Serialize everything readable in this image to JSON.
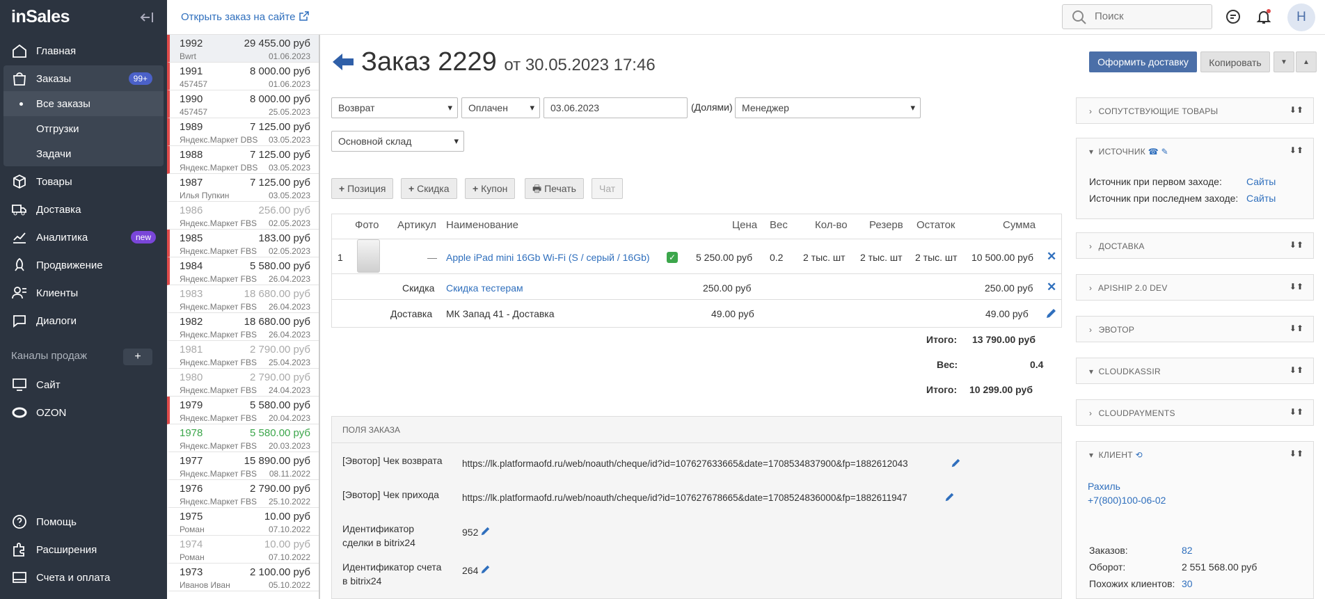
{
  "app": {
    "logo": "inSales",
    "open_site": "Открыть заказ на сайте",
    "search_placeholder": "Поиск",
    "avatar": "Н"
  },
  "nav": {
    "main": "Главная",
    "orders": "Заказы",
    "orders_badge": "99+",
    "all_orders": "Все заказы",
    "shipments": "Отгрузки",
    "tasks": "Задачи",
    "products": "Товары",
    "delivery": "Доставка",
    "analytics": "Аналитика",
    "analytics_badge": "new",
    "promo": "Продвижение",
    "clients": "Клиенты",
    "dialogs": "Диалоги",
    "channels": "Каналы продаж",
    "channels_plus": "+",
    "site": "Сайт",
    "ozon": "OZON",
    "help": "Помощь",
    "extensions": "Расширения",
    "billing": "Счета и оплата"
  },
  "orders": [
    {
      "num": "1992",
      "sum": "29 455.00 руб",
      "src": "Bwrt",
      "date": "01.06.2023",
      "flag": "red"
    },
    {
      "num": "1991",
      "sum": "8 000.00 руб",
      "src": "457457",
      "date": "01.06.2023",
      "flag": "red"
    },
    {
      "num": "1990",
      "sum": "8 000.00 руб",
      "src": "457457",
      "date": "25.05.2023",
      "flag": "red"
    },
    {
      "num": "1989",
      "sum": "7 125.00 руб",
      "src": "Яндекс.Маркет DBS",
      "date": "03.05.2023",
      "flag": "red"
    },
    {
      "num": "1988",
      "sum": "7 125.00 руб",
      "src": "Яндекс.Маркет DBS",
      "date": "03.05.2023",
      "flag": "red"
    },
    {
      "num": "1987",
      "sum": "7 125.00 руб",
      "src": "Илья Пупкин",
      "date": "03.05.2023",
      "flag": ""
    },
    {
      "num": "1986",
      "sum": "256.00 руб",
      "src": "Яндекс.Маркет FBS",
      "date": "02.05.2023",
      "flag": "muted"
    },
    {
      "num": "1985",
      "sum": "183.00 руб",
      "src": "Яндекс.Маркет FBS",
      "date": "02.05.2023",
      "flag": "red"
    },
    {
      "num": "1984",
      "sum": "5 580.00 руб",
      "src": "Яндекс.Маркет FBS",
      "date": "26.04.2023",
      "flag": "red"
    },
    {
      "num": "1983",
      "sum": "18 680.00 руб",
      "src": "Яндекс.Маркет FBS",
      "date": "26.04.2023",
      "flag": "muted"
    },
    {
      "num": "1982",
      "sum": "18 680.00 руб",
      "src": "Яндекс.Маркет FBS",
      "date": "26.04.2023",
      "flag": ""
    },
    {
      "num": "1981",
      "sum": "2 790.00 руб",
      "src": "Яндекс.Маркет FBS",
      "date": "25.04.2023",
      "flag": "muted"
    },
    {
      "num": "1980",
      "sum": "2 790.00 руб",
      "src": "Яндекс.Маркет FBS",
      "date": "24.04.2023",
      "flag": "muted"
    },
    {
      "num": "1979",
      "sum": "5 580.00 руб",
      "src": "Яндекс.Маркет FBS",
      "date": "20.04.2023",
      "flag": "red"
    },
    {
      "num": "1978",
      "sum": "5 580.00 руб",
      "src": "Яндекс.Маркет FBS",
      "date": "20.03.2023",
      "flag": "green"
    },
    {
      "num": "1977",
      "sum": "15 890.00 руб",
      "src": "Яндекс.Маркет FBS",
      "date": "08.11.2022",
      "flag": ""
    },
    {
      "num": "1976",
      "sum": "2 790.00 руб",
      "src": "Яндекс.Маркет FBS",
      "date": "25.10.2022",
      "flag": ""
    },
    {
      "num": "1975",
      "sum": "10.00 руб",
      "src": "Роман",
      "date": "07.10.2022",
      "flag": ""
    },
    {
      "num": "1974",
      "sum": "10.00 руб",
      "src": "Роман",
      "date": "07.10.2022",
      "flag": "muted"
    },
    {
      "num": "1973",
      "sum": "2 100.00 руб",
      "src": "Иванов Иван",
      "date": "05.10.2022",
      "flag": ""
    }
  ],
  "order": {
    "title": "Заказ 2229",
    "date": "от 30.05.2023 17:46",
    "status": "Возврат",
    "payment": "Оплачен",
    "pay_date": "03.06.2023",
    "pay_method": "(Долями)",
    "manager": "Менеджер",
    "warehouse": "Основной склад"
  },
  "header_buttons": {
    "deliver": "Оформить доставку",
    "copy": "Копировать"
  },
  "actions": {
    "position": "Позиция",
    "discount": "Скидка",
    "coupon": "Купон",
    "print": "Печать",
    "chat": "Чат"
  },
  "table": {
    "cols": {
      "photo": "Фото",
      "sku": "Артикул",
      "name": "Наименование",
      "price": "Цена",
      "weight": "Вес",
      "qty": "Кол-во",
      "reserve": "Резерв",
      "stock": "Остаток",
      "sum": "Сумма"
    },
    "item": {
      "n": "1",
      "sku": "—",
      "name": "Apple iPad mini 16Gb Wi-Fi (S / серый / 16Gb)",
      "price": "5 250.00 руб",
      "weight": "0.2",
      "qty": "2 тыс. шт",
      "reserve": "2 тыс. шт",
      "stock": "2 тыс. шт",
      "sum": "10 500.00 руб"
    },
    "discount": {
      "label": "Скидка",
      "name": "Скидка тестерам",
      "price": "250.00 руб",
      "sum": "250.00 руб"
    },
    "delivery": {
      "label": "Доставка",
      "name": "МК Запад 41 - Доставка",
      "price": "49.00 руб",
      "sum": "49.00 руб"
    }
  },
  "totals": {
    "total_label": "Итого:",
    "total": "13 790.00 руб",
    "weight_label": "Вес:",
    "weight": "0.4",
    "final_label": "Итого:",
    "final": "10 299.00 руб"
  },
  "fields": {
    "header": "ПОЛЯ ЗАКАЗА",
    "refund_label": "[Эвотор] Чек возврата",
    "refund_value": "https://lk.platformaofd.ru/web/noauth/cheque/id?id=107627633665&date=1708534837900&fp=1882612043",
    "income_label": "[Эвотор] Чек прихода",
    "income_value": "https://lk.platformaofd.ru/web/noauth/cheque/id?id=107627678665&date=1708524836000&fp=1882611947",
    "deal_label_1": "Идентификатор",
    "deal_label_2": "сделки в bitrix24",
    "deal_value": "952",
    "invoice_label_1": "Идентификатор счета",
    "invoice_label_2": "в bitrix24",
    "invoice_value": "264"
  },
  "panels": {
    "related": "СОПУТСТВУЮЩИЕ ТОВАРЫ",
    "source": "ИСТОЧНИК",
    "source_first": "Источник при первом заходе:",
    "source_first_val": "Сайты",
    "source_last": "Источник при последнем заходе:",
    "source_last_val": "Сайты",
    "delivery": "ДОСТАВКА",
    "apiship": "APISHIP 2.0 DEV",
    "evotor": "ЭВОТОР",
    "cloudkassir": "CLOUDKASSIR",
    "cloudpayments": "CLOUDPAYMENTS",
    "client": "КЛИЕНТ",
    "client_name": "Рахиль",
    "client_phone": "+7(800)100-06-02",
    "orders_label": "Заказов:",
    "orders_val": "82",
    "turnover_label": "Оборот:",
    "turnover_val": "2 551 568.00 руб",
    "similar_label": "Похожих клиентов:",
    "similar_val": "30"
  },
  "colors": {
    "sidebar": "#2c3440",
    "accent": "#4b6fa8",
    "link": "#2f6fbd",
    "red_flag": "#e04b4b",
    "green": "#3ca64b"
  }
}
